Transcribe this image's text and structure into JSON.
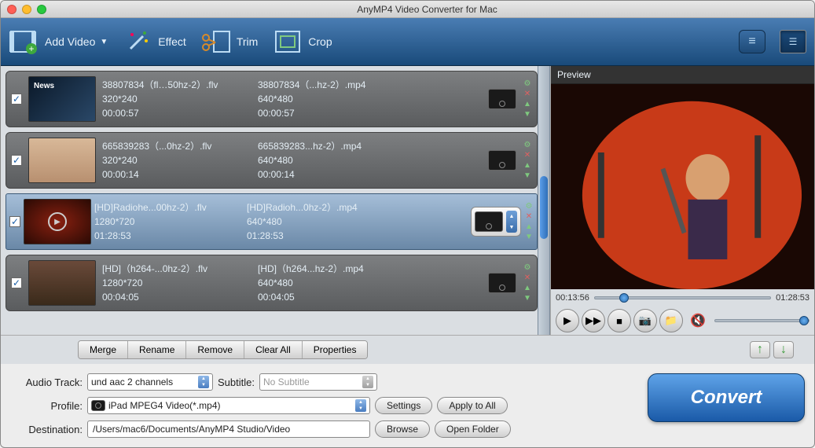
{
  "window": {
    "title": "AnyMP4 Video Converter for Mac"
  },
  "toolbar": {
    "add_video": "Add Video",
    "effect": "Effect",
    "trim": "Trim",
    "crop": "Crop"
  },
  "rows": [
    {
      "src_name": "38807834（fl…50hz-2）.flv",
      "src_res": "320*240",
      "src_dur": "00:00:57",
      "out_name": "38807834（...hz-2）.mp4",
      "out_res": "640*480",
      "out_dur": "00:00:57"
    },
    {
      "src_name": "665839283（...0hz-2）.flv",
      "src_res": "320*240",
      "src_dur": "00:00:14",
      "out_name": "665839283...hz-2）.mp4",
      "out_res": "640*480",
      "out_dur": "00:00:14"
    },
    {
      "src_name": "[HD]Radiohe...00hz-2）.flv",
      "src_res": "1280*720",
      "src_dur": "01:28:53",
      "out_name": "[HD]Radioh...0hz-2）.mp4",
      "out_res": "640*480",
      "out_dur": "01:28:53"
    },
    {
      "src_name": "[HD]（h264-...0hz-2）.flv",
      "src_res": "1280*720",
      "src_dur": "00:04:05",
      "out_name": "[HD]（h264...hz-2）.mp4",
      "out_res": "640*480",
      "out_dur": "00:04:05"
    }
  ],
  "actions": {
    "merge": "Merge",
    "rename": "Rename",
    "remove": "Remove",
    "clear_all": "Clear All",
    "properties": "Properties"
  },
  "preview": {
    "label": "Preview",
    "current": "00:13:56",
    "total": "01:28:53"
  },
  "form": {
    "audio_track_label": "Audio Track:",
    "audio_track_value": "und aac 2 channels",
    "subtitle_label": "Subtitle:",
    "subtitle_value": "No Subtitle",
    "profile_label": "Profile:",
    "profile_value": "iPad MPEG4 Video(*.mp4)",
    "settings": "Settings",
    "apply_all": "Apply to All",
    "destination_label": "Destination:",
    "destination_value": "/Users/mac6/Documents/AnyMP4 Studio/Video",
    "browse": "Browse",
    "open_folder": "Open Folder",
    "convert": "Convert"
  }
}
